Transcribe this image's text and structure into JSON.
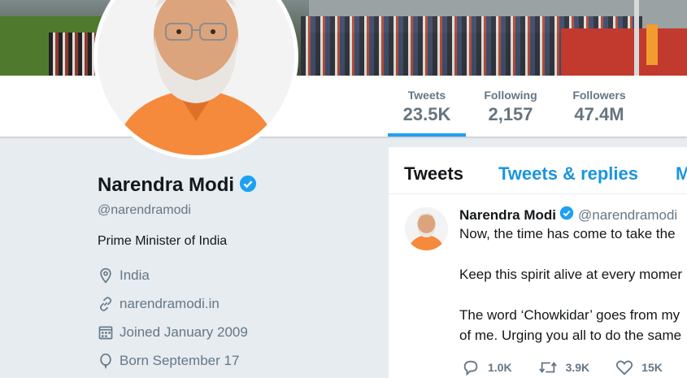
{
  "banner": {
    "description_icon": "event-photo"
  },
  "nav": {
    "items": [
      {
        "label": "Tweets",
        "value": "23.5K",
        "active": true
      },
      {
        "label": "Following",
        "value": "2,157",
        "active": false
      },
      {
        "label": "Followers",
        "value": "47.4M",
        "active": false
      }
    ]
  },
  "profile": {
    "name": "Narendra Modi",
    "handle": "@narendramodi",
    "bio": "Prime Minister of India",
    "location": "India",
    "website": "narendramodi.in",
    "joined": "Joined January 2009",
    "born": "Born September 17"
  },
  "tabs": {
    "tweets": "Tweets",
    "replies": "Tweets & replies",
    "media": "M"
  },
  "tweet": {
    "name": "Narendra Modi",
    "handle": "@narendramodi",
    "line1": "Now, the time has come to take the",
    "line2": "Keep this spirit alive at every momer",
    "line3": "The word ‘Chowkidar’ goes from my",
    "line4": "of me. Urging you all to do the same",
    "replies": "1.0K",
    "retweets": "3.9K",
    "likes": "15K"
  },
  "colors": {
    "accent": "#1da1f2",
    "link": "#1b95e0",
    "muted": "#657786",
    "background": "#e6ecf0"
  }
}
